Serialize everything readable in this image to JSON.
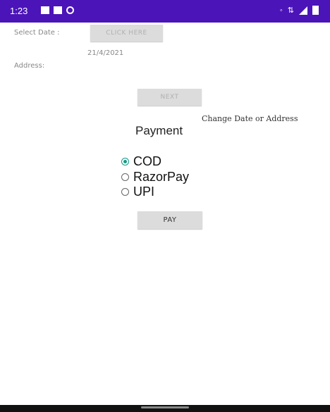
{
  "status_bar": {
    "time": "1:23",
    "left_icons": [
      "notification-icon",
      "app-icon",
      "circle-icon"
    ],
    "right_icons": [
      "wifi-icon",
      "data-icon",
      "signal-icon",
      "battery-icon"
    ]
  },
  "date_section": {
    "label": "Select Date :",
    "button_label": "CLICK HERE",
    "selected_date": "21/4/2021"
  },
  "address_section": {
    "label": "Address:"
  },
  "next_button_label": "NEXT",
  "change_link": "Change Date or Address",
  "payment": {
    "title": "Payment",
    "options": [
      {
        "label": "COD",
        "selected": true
      },
      {
        "label": "RazorPay",
        "selected": false
      },
      {
        "label": "UPI",
        "selected": false
      }
    ],
    "accent": "#159a86",
    "pay_button_label": "PAY"
  },
  "theme": {
    "status_bar_color": "#4b14b8"
  }
}
